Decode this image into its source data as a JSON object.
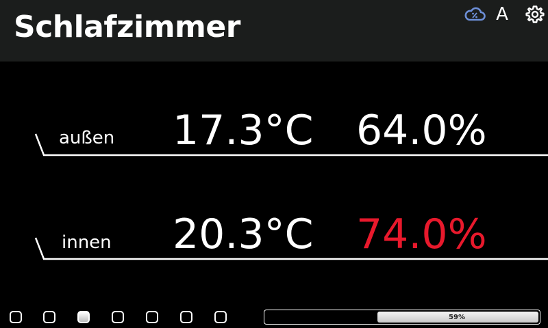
{
  "header": {
    "title": "Schlafzimmer",
    "icons": [
      "cloud-percent-icon",
      "font-icon",
      "gear-icon"
    ],
    "font_letter": "A"
  },
  "readings": [
    {
      "label": "außen",
      "temperature": "17.3°C",
      "humidity": "64.0%",
      "humidity_alert": false
    },
    {
      "label": "innen",
      "temperature": "20.3°C",
      "humidity": "74.0%",
      "humidity_alert": true
    }
  ],
  "pager": {
    "pages": 7,
    "active_index": 2
  },
  "progress": {
    "value": 0.59,
    "label": "59%"
  },
  "colors": {
    "background": "#000000",
    "header": "#1b1d1c",
    "text": "#ffffff",
    "alert": "#e8192c",
    "cloud_icon": "#6d8fd8"
  }
}
